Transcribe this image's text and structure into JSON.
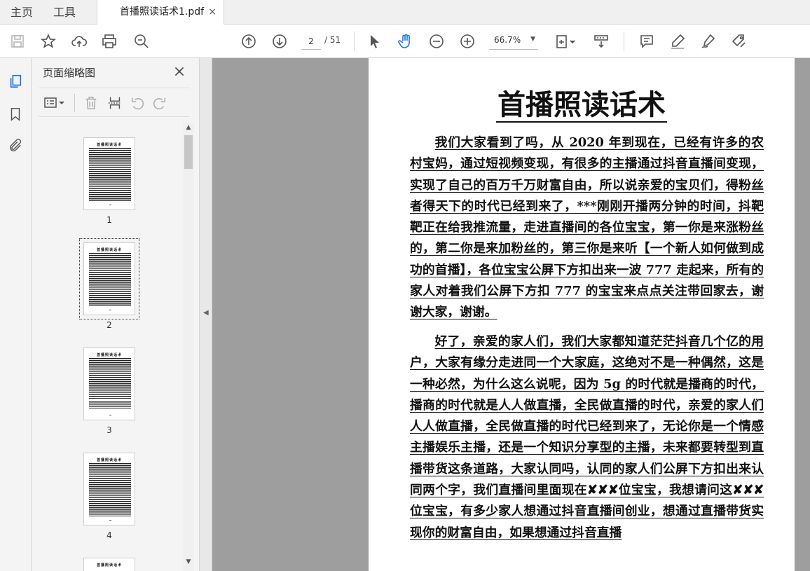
{
  "menu": {
    "home": "主页",
    "tools": "工具"
  },
  "tab": {
    "title": "首播照读话术1.pdf",
    "close": "×"
  },
  "toolbar": {
    "current_page": "2",
    "total_pages": "/ 51",
    "zoom": "66.7%"
  },
  "panel": {
    "title": "页面缩略图",
    "thumbnails": [
      {
        "num": "1",
        "title": "首播照读话术"
      },
      {
        "num": "2",
        "title": "首播照读话术"
      },
      {
        "num": "3",
        "title": "首播照读话术"
      },
      {
        "num": "4",
        "title": "首播照读话术"
      },
      {
        "num": "",
        "title": "首播照读话术"
      }
    ]
  },
  "document": {
    "title": "首播照读话术",
    "paragraphs": [
      "我们大家看到了吗，从 2020 年到现在，已经有许多的农村宝妈，通过短视频变现，有很多的主播通过抖音直播间变现，实现了自己的百万千万财富自由，所以说亲爱的宝贝们，得粉丝者得天下的时代已经到来了，***刚刚开播两分钟的时间，抖靶靶正在给我推流量，走进直播间的各位宝宝，第一你是来涨粉丝的，第二你是来加粉丝的，第三你是来听【一个新人如何做到成功的首播】，各位宝宝公屏下方扣出来一波 777 走起来，所有的家人对着我们公屏下方扣 777 的宝宝来点点关注带回家去，谢谢大家，谢谢。",
      "好了，亲爱的家人们，我们大家都知道茫茫抖音几个亿的用户，大家有缘分走进同一个大家庭，这绝对不是一种偶然，这是一种必然，为什么这么说呢，因为 5g 的时代就是播商的时代，播商的时代就是人人做直播，全民做直播的时代，亲爱的家人们人人做直播，全民做直播的时代已经到来了，无论你是一个情感主播娱乐主播，还是一个知识分享型的主播，未来都要转型到直播带货这条道路，大家认同吗，认同的家人们公屏下方扣出来认同两个字，我们直播间里面现在✘✘✘位宝宝，我想请问这✘✘✘位宝宝，有多少家人想通过抖音直播间创业，想通过直播带货实现你的财富自由，如果想通过抖音直播"
    ]
  },
  "colors": {
    "doc_background": "#9e9e9e",
    "panel_background": "#f4f4f4",
    "accent": "#1a73e8"
  }
}
